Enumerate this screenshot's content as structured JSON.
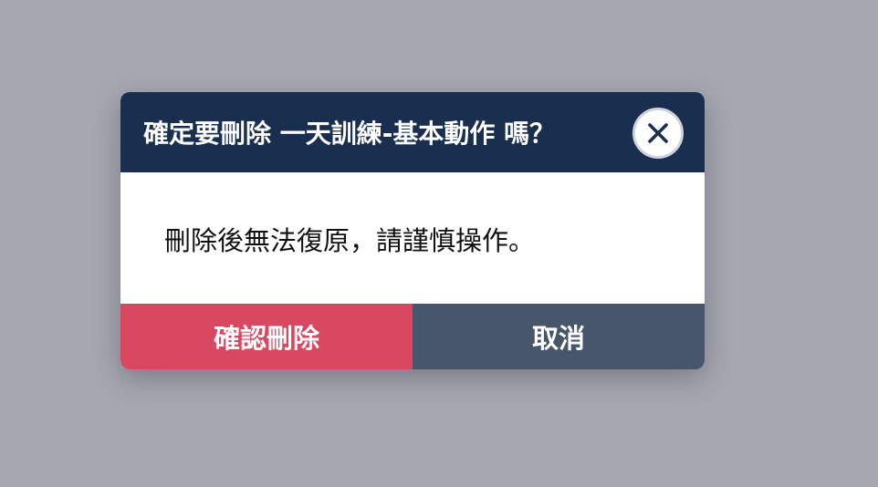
{
  "dialog": {
    "title": "確定要刪除 一天訓練-基本動作 嗎？",
    "close_icon": "close-icon",
    "message": "刪除後無法復原，請謹慎操作。",
    "confirm_label": "確認刪除",
    "cancel_label": "取消"
  },
  "colors": {
    "overlay": "#a6a8b0",
    "header": "#1a2e4f",
    "confirm": "#d84860",
    "cancel": "#48566b"
  }
}
